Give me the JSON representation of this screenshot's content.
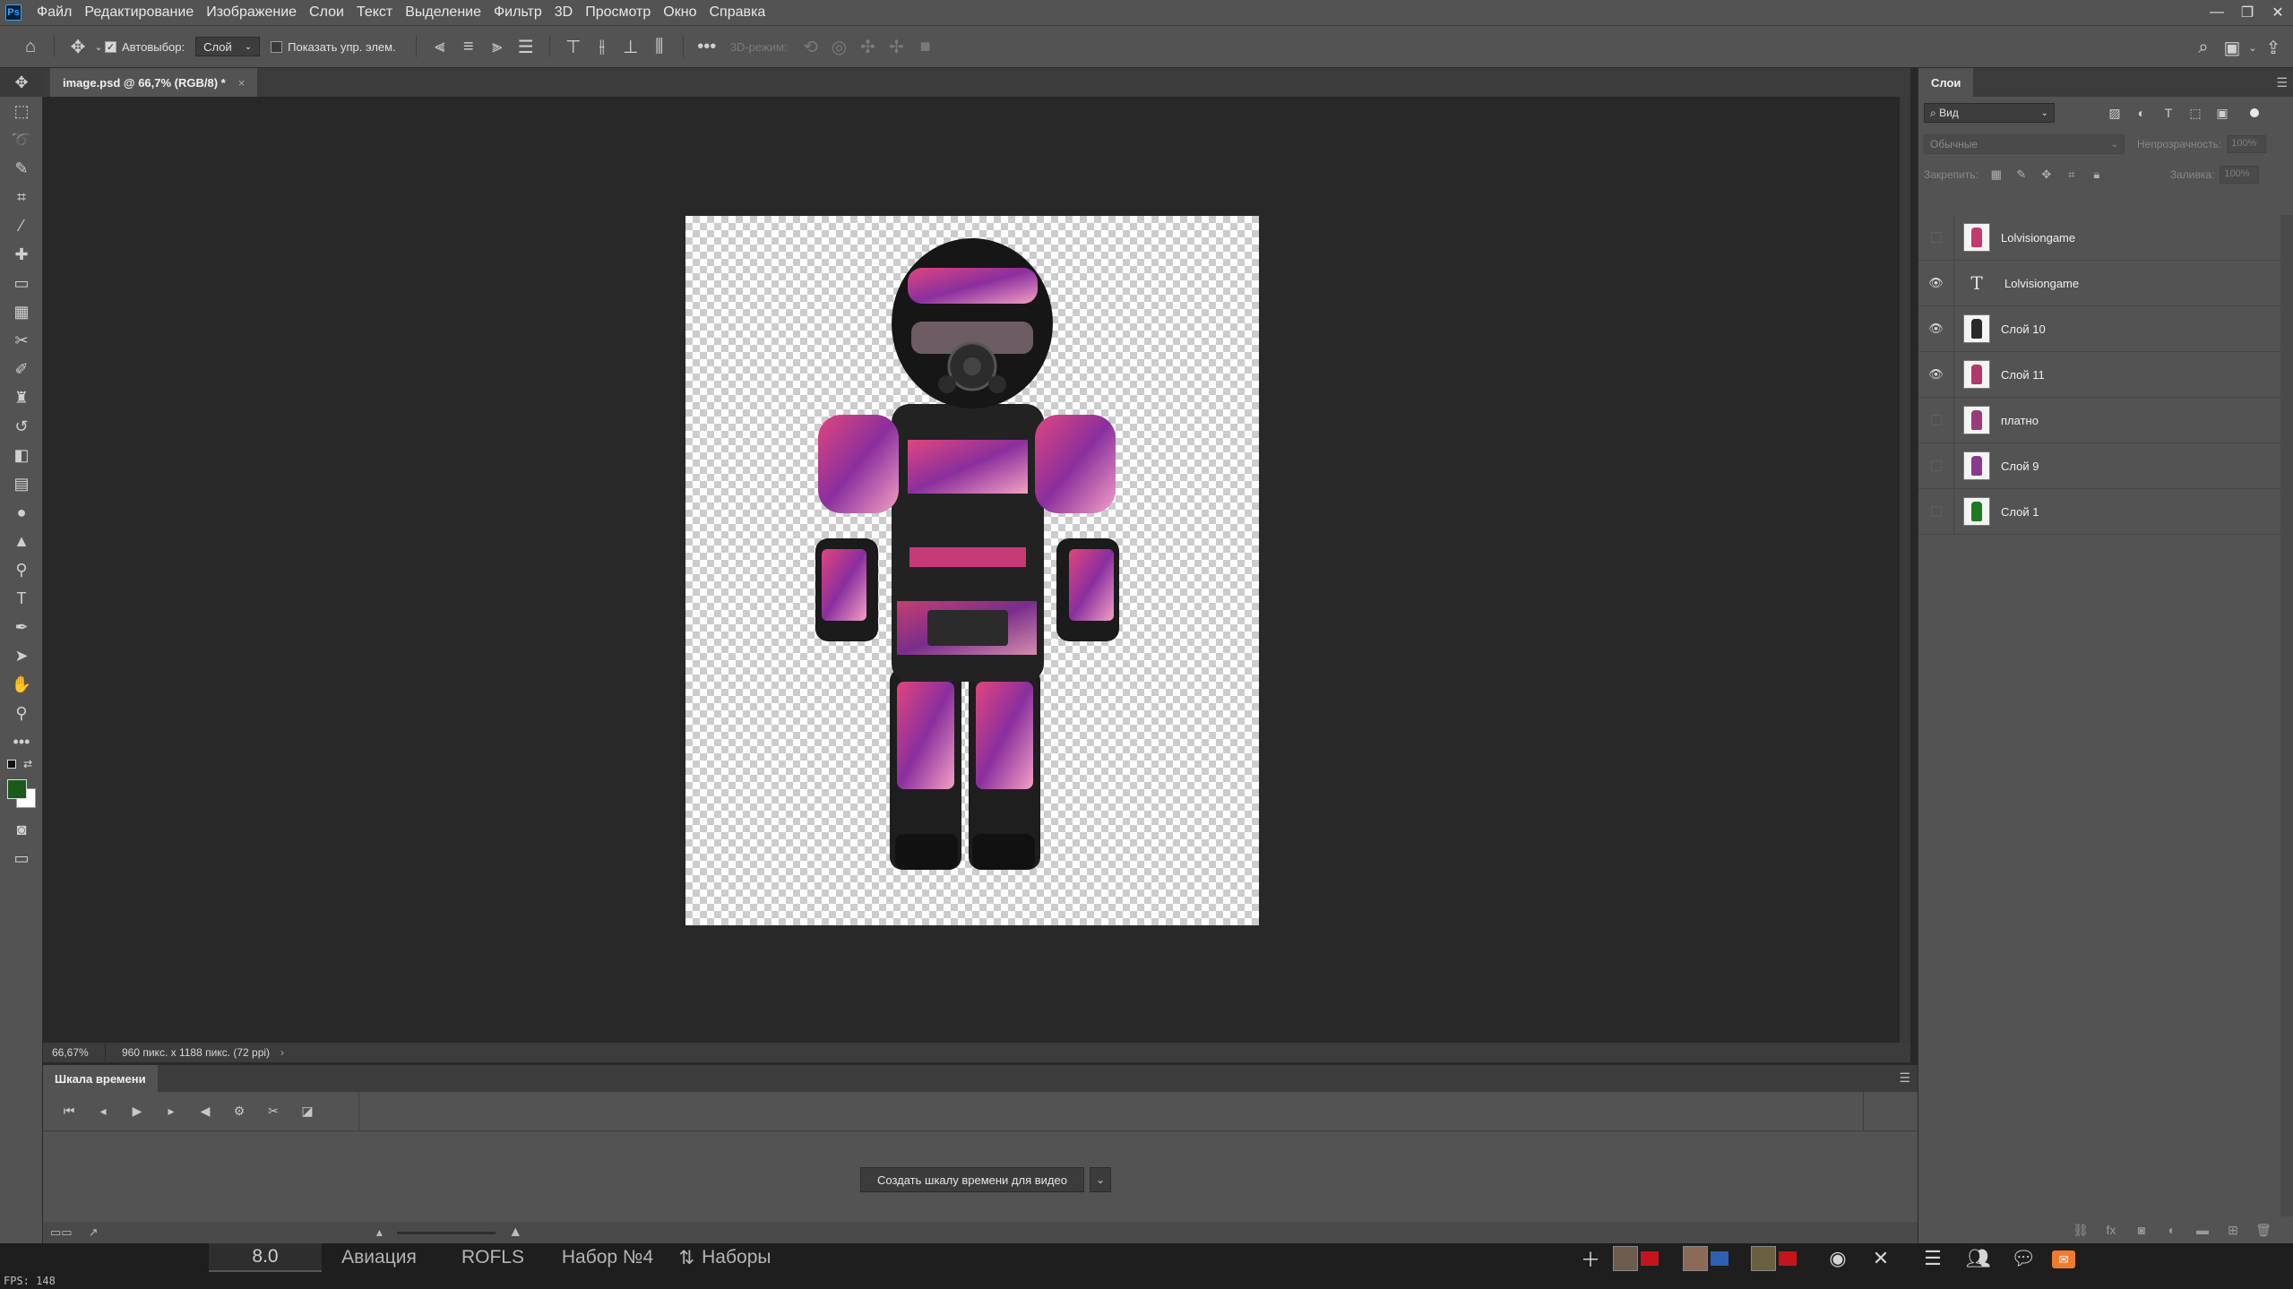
{
  "menu": {
    "logo": "Ps",
    "items": [
      "Файл",
      "Редактирование",
      "Изображение",
      "Слои",
      "Текст",
      "Выделение",
      "Фильтр",
      "3D",
      "Просмотр",
      "Окно",
      "Справка"
    ]
  },
  "options": {
    "autoselect_label": "Автовыбор:",
    "autoselect_value": "Слой",
    "show_controls_label": "Показать упр. элем.",
    "mode3d_label": "3D-режим:"
  },
  "document": {
    "tab_title": "image.psd @ 66,7% (RGB/8) *",
    "close": "×"
  },
  "status": {
    "zoom": "66,67%",
    "info": "960 пикс. x 1188 пикс. (72 ppi)",
    "arrow": "›"
  },
  "timeline": {
    "tab": "Шкала времени",
    "create_button": "Создать шкалу времени для видео"
  },
  "layers_panel": {
    "tab": "Слои",
    "filter_value": "Вид",
    "blend_mode": "Обычные",
    "opacity_label": "Непрозрачность:",
    "opacity_value": "100%",
    "lock_label": "Закрепить:",
    "fill_label": "Заливка:",
    "fill_value": "100%",
    "layers": [
      {
        "name": "Lolvisiongame",
        "visible": false,
        "kind": "image",
        "thumb_color": "#c23a6e"
      },
      {
        "name": "Lolvisiongame",
        "visible": true,
        "kind": "text",
        "thumb_color": ""
      },
      {
        "name": "Слой 10",
        "visible": true,
        "kind": "image",
        "thumb_color": "#2a2a2a"
      },
      {
        "name": "Слой 11",
        "visible": true,
        "kind": "image",
        "thumb_color": "#b0386a"
      },
      {
        "name": "платно",
        "visible": false,
        "kind": "image",
        "thumb_color": "#9a3c78"
      },
      {
        "name": "Слой 9",
        "visible": false,
        "kind": "image",
        "thumb_color": "#8a3a8e"
      },
      {
        "name": "Слой 1",
        "visible": false,
        "kind": "image",
        "thumb_color": "#1f7a1f"
      }
    ]
  },
  "game_bar": {
    "fps": "FPS: 148",
    "tabs": [
      "8.0",
      "Авиация",
      "ROFLS",
      "Набор №4",
      "Наборы"
    ]
  },
  "colors": {
    "foreground": "#1a5a1a",
    "background": "#ffffff",
    "accent": "#31a8ff"
  }
}
